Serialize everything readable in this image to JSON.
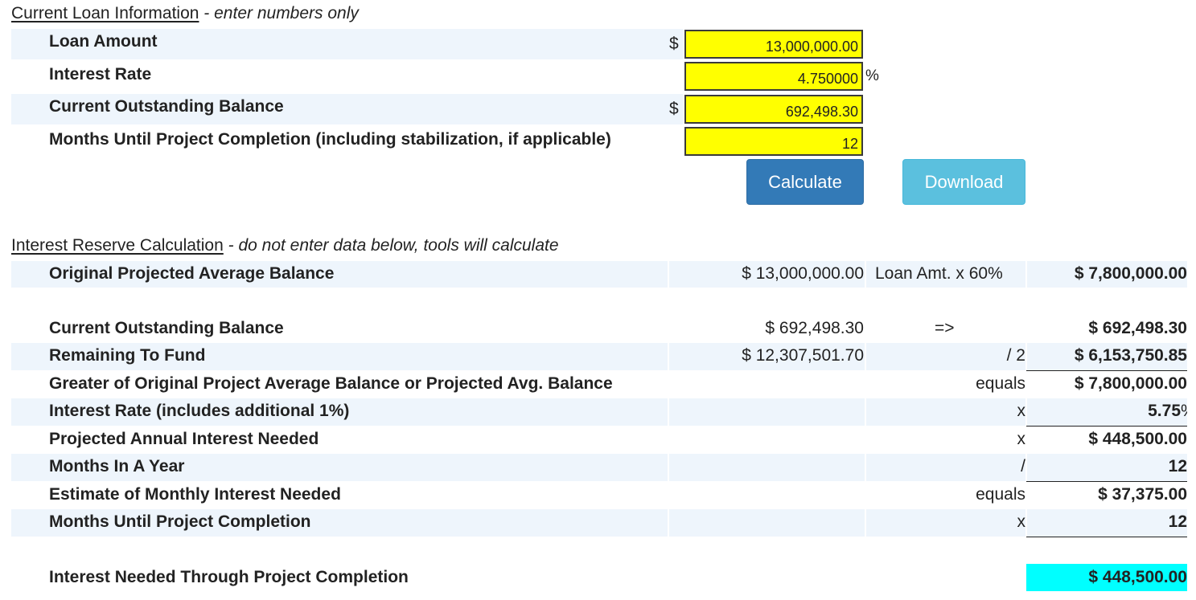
{
  "loan_section": {
    "title": "Current Loan Information",
    "note": " - enter numbers only",
    "rows": [
      {
        "label": "Loan Amount",
        "prefix": "$",
        "value": "13,000,000.00",
        "suffix": ""
      },
      {
        "label": "Interest Rate",
        "prefix": "",
        "value": "4.750000",
        "suffix": "%"
      },
      {
        "label": "Current Outstanding Balance",
        "prefix": "$",
        "value": "692,498.30",
        "suffix": ""
      },
      {
        "label": "Months Until Project Completion (including stabilization, if applicable)",
        "prefix": "",
        "value": "12",
        "suffix": ""
      }
    ],
    "calculate_label": "Calculate",
    "download_label": "Download"
  },
  "reserve_section": {
    "title": "Interest Reserve Calculation",
    "note": " - do not enter data below, tools will calculate",
    "rows": [
      {
        "label": "Original Projected Average Balance",
        "mid": "$ 13,000,000.00",
        "op": "Loan Amt. x 60%",
        "result": "$ 7,800,000.00"
      },
      {
        "label": "Current Outstanding Balance",
        "mid": "$ 692,498.30",
        "op": "=>",
        "result": "$ 692,498.30"
      },
      {
        "label": "Remaining To Fund",
        "mid": "$ 12,307,501.70",
        "op": "/ 2",
        "result": "$ 6,153,750.85"
      },
      {
        "label": "Greater of Original Project Average Balance or Projected Avg. Balance",
        "mid": "",
        "op": "equals",
        "result": "$ 7,800,000.00"
      },
      {
        "label": "Interest Rate (includes additional 1%)",
        "mid": "",
        "op": "x",
        "result": "5.75"
      },
      {
        "label": "Projected Annual Interest Needed",
        "mid": "",
        "op": "x",
        "result": "$ 448,500.00"
      },
      {
        "label": "Months In A Year",
        "mid": "",
        "op": "/",
        "result": "12"
      },
      {
        "label": "Estimate of Monthly Interest Needed",
        "mid": "",
        "op": "equals",
        "result": "$ 37,375.00"
      },
      {
        "label": "Months Until Project Completion",
        "mid": "",
        "op": "x",
        "result": "12"
      }
    ],
    "rate_suffix": "%",
    "total": {
      "label": "Interest Needed Through Project Completion",
      "result": "$ 448,500.00"
    }
  },
  "colors": {
    "input_bg": "#ffff00",
    "band": "#eef5fc",
    "total_bg": "#00ffff",
    "calc_btn": "#337ab7",
    "download_btn": "#5bc0de"
  }
}
